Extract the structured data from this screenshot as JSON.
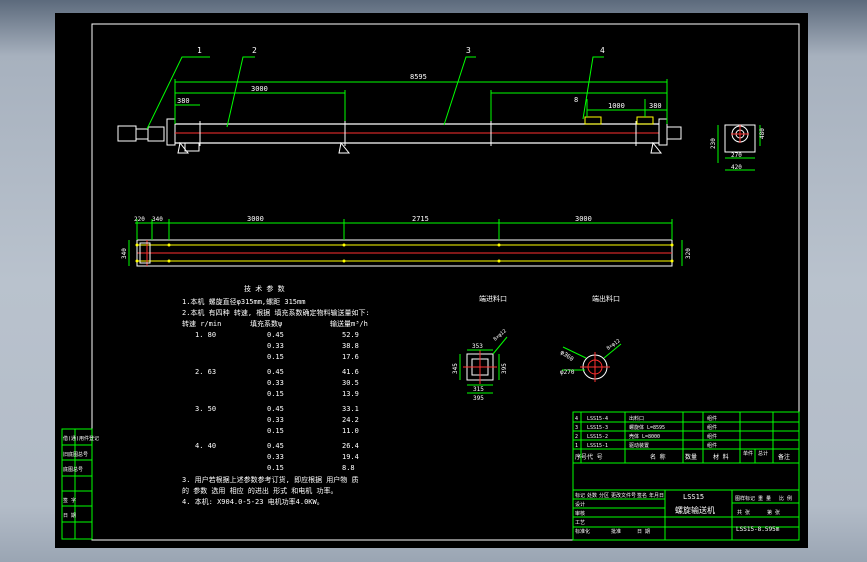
{
  "drawing": {
    "part_labels": [
      "1",
      "2",
      "3",
      "4"
    ],
    "dims": {
      "top_total": "8595",
      "top_seg": "3000",
      "top_start": "380",
      "top_1000": "1000",
      "top_380b": "380",
      "top_8": "8",
      "side_w": "480",
      "side_h": "230",
      "side_a": "420",
      "side_b": "270",
      "plan_220": "220",
      "plan_340": "340",
      "plan_3000a": "3000",
      "plan_2715": "2715",
      "plan_3000b": "3000",
      "plan_left": "340",
      "plan_right": "320"
    },
    "detail_titles": [
      "端进料口",
      "端出料口"
    ],
    "detail_dims": {
      "a_top": "353",
      "a_side": "385",
      "a_left": "345",
      "a_right": "395",
      "a_inner": "315",
      "a_bottom": "395",
      "a_holes": "8×φ12",
      "b_dia1": "φ360",
      "b_dia2": "φ270",
      "b_holes": "8×φ12"
    }
  },
  "notes": {
    "title": "技 术 参 数",
    "lines": [
      "1.本机 螺旋直径φ315mm,螺距 315mm",
      "2.本机 有四种 转速, 根据 填充系数确定物料输送量如下:"
    ],
    "header": [
      "转速 r/min",
      "填充系数ψ",
      "输送量m³/h"
    ],
    "rows": [
      {
        "speed": "1. 80",
        "fills": [
          "0.45",
          "0.33",
          "0.15"
        ],
        "outputs": [
          "52.9",
          "38.8",
          "17.6"
        ]
      },
      {
        "speed": "2. 63",
        "fills": [
          "0.45",
          "0.33",
          "0.15"
        ],
        "outputs": [
          "41.6",
          "30.5",
          "13.9"
        ]
      },
      {
        "speed": "3. 50",
        "fills": [
          "0.45",
          "0.33",
          "0.15"
        ],
        "outputs": [
          "33.1",
          "24.2",
          "11.0"
        ]
      },
      {
        "speed": "4. 40",
        "fills": [
          "0.45",
          "0.33",
          "0.15"
        ],
        "outputs": [
          "26.4",
          "19.4",
          "8.8"
        ]
      }
    ],
    "footer": [
      "3. 用户若根据上述参数参考订货, 即应根据 用户物 质",
      "的 参数 选用 相应 的进出 形式 和电机 功率。",
      "4. 本机: X904.0-5-23 电机功率4.0KW。"
    ]
  },
  "left_strip": [
    "借(通)用件登记",
    "旧底图总号",
    "底图总号",
    "签 字",
    "日 期"
  ],
  "title_block": {
    "bom": [
      {
        "no": "4",
        "name": "LSS15-4",
        "desc": "出料口",
        "note": "组件"
      },
      {
        "no": "3",
        "name": "LSS15-3",
        "desc": "螺旋体 L=8595",
        "note": "组件"
      },
      {
        "no": "2",
        "name": "LSS15-2",
        "desc": "壳体 L=8000",
        "note": "组件"
      },
      {
        "no": "1",
        "name": "LSS15-1",
        "desc": "驱动装置",
        "note": "组件"
      }
    ],
    "bom_header": [
      "序号",
      "代 号",
      "名 称",
      "数量",
      "材 料",
      "单件",
      "总计",
      "备注"
    ],
    "model": "LSS15",
    "product_name": "螺旋输送机",
    "stage_label": "图样标记",
    "weight_label": "重 量",
    "scale_label": "比 例",
    "drawing_no": "LSS15-8.595m",
    "sheet_label": "共 张",
    "sheet_of": "第 张",
    "roles": [
      "设计",
      "审核",
      "工艺",
      "标准化",
      "批准"
    ],
    "rev_header": [
      "标记",
      "处数",
      "分区",
      "更改文件号",
      "签名",
      "年月日"
    ],
    "date_label": "日 期"
  }
}
